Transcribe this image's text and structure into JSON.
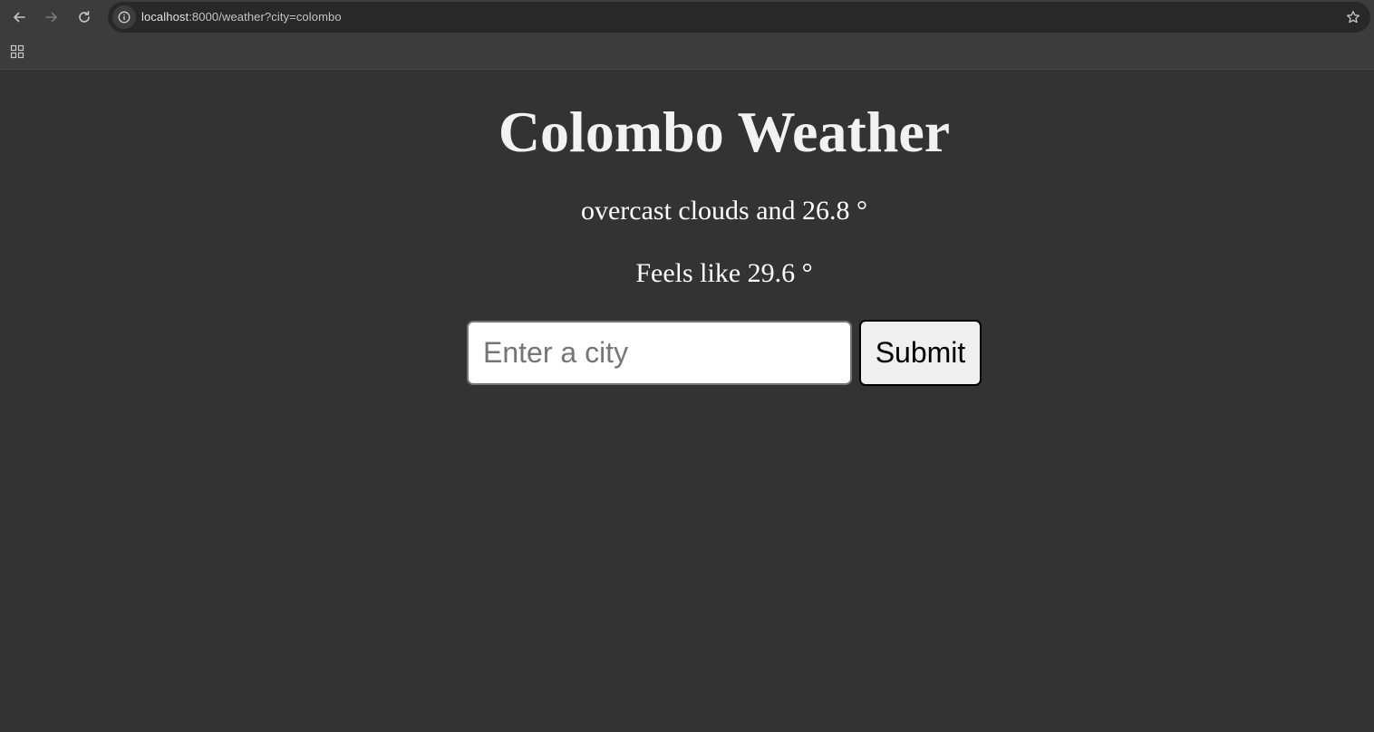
{
  "browser": {
    "url_host": "localhost",
    "url_rest": ":8000/weather?city=colombo",
    "icons": {
      "back": "back-arrow-icon",
      "forward": "forward-arrow-icon",
      "reload": "reload-icon",
      "site_info": "info-icon",
      "bookmark": "star-icon",
      "apps": "apps-grid-icon"
    }
  },
  "weather": {
    "title": "Colombo Weather",
    "description": "overcast clouds and 26.8 °",
    "feels_like": "Feels like 29.6 °"
  },
  "form": {
    "city_placeholder": "Enter a city",
    "city_value": "",
    "submit_label": "Submit"
  },
  "colors": {
    "page_background": "#333333",
    "browser_toolbar": "#3c3c3c",
    "omnibox": "#282828"
  }
}
